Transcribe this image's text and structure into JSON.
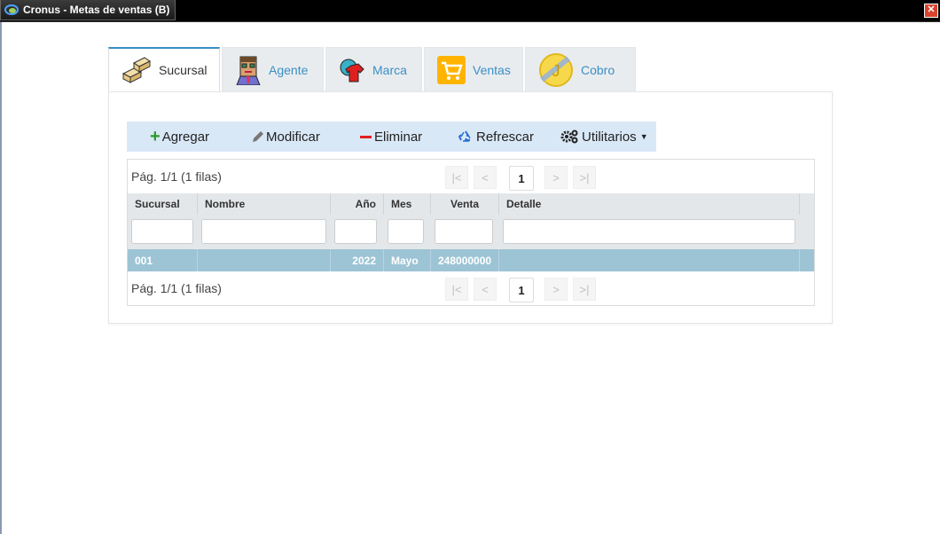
{
  "window": {
    "title": "Cronus - Metas de ventas (B)",
    "close_glyph": "✕"
  },
  "tabs": [
    {
      "label": "Sucursal",
      "icon": "boxes-icon",
      "active": true
    },
    {
      "label": "Agente",
      "icon": "agent-icon",
      "active": false
    },
    {
      "label": "Marca",
      "icon": "brand-icon",
      "active": false
    },
    {
      "label": "Ventas",
      "icon": "cart-icon",
      "active": false
    },
    {
      "label": "Cobro",
      "icon": "coin-icon",
      "active": false
    }
  ],
  "toolbar": {
    "add_label": "Agregar",
    "edit_label": "Modificar",
    "delete_label": "Eliminar",
    "refresh_label": "Refrescar",
    "utilities_label": "Utilitarios"
  },
  "colors": {
    "accent": "#3a8fc5",
    "selected_row": "#9dc4d5",
    "toolbar_bg": "#d9e8f7",
    "add_green": "#2a9a2a",
    "delete_red": "#e02020"
  },
  "pager": {
    "info": "Pág. 1/1 (1 filas)",
    "page": "1",
    "first": "|<",
    "prev": "<",
    "next": ">",
    "last": ">|"
  },
  "table": {
    "columns": [
      "Sucursal",
      "Nombre",
      "Año",
      "Mes",
      "Venta",
      "Detalle"
    ],
    "rows": [
      {
        "sucursal": "001",
        "nombre": "",
        "anio": "2022",
        "mes": "Mayo",
        "venta": "248000000",
        "detalle": ""
      }
    ]
  }
}
